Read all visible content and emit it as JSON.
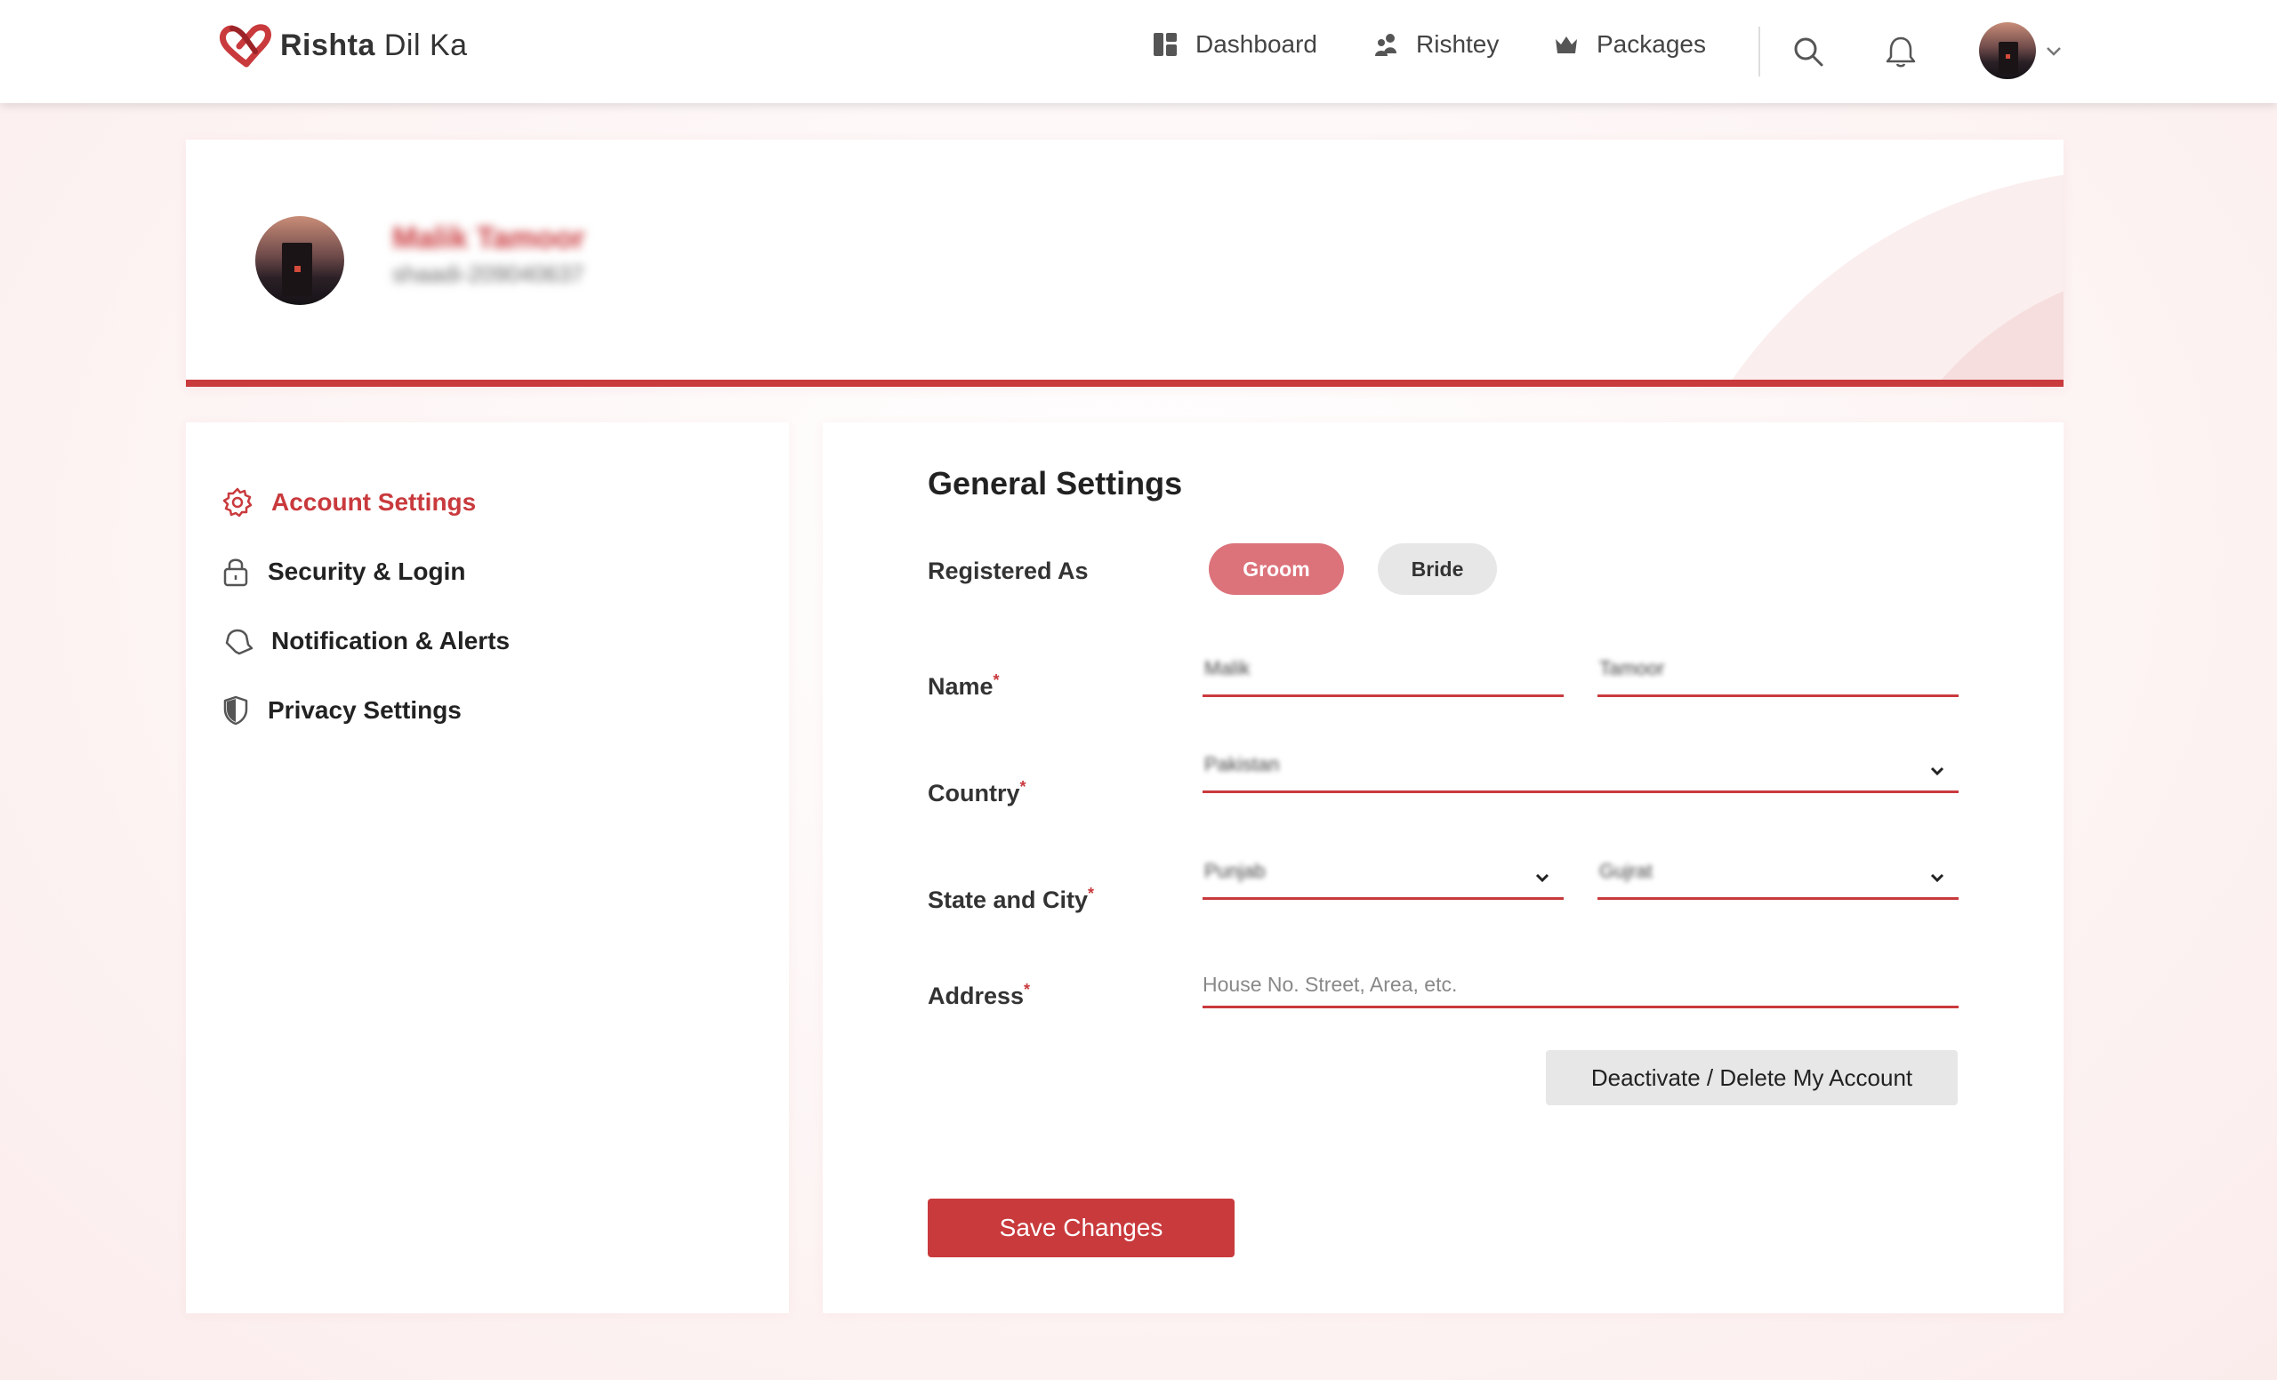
{
  "brand": {
    "name_bold": "Rishta",
    "name_light": " Dil Ka",
    "accent": "#c93a3d"
  },
  "nav": {
    "items": [
      {
        "label": "Dashboard",
        "icon": "dashboard-icon"
      },
      {
        "label": "Rishtey",
        "icon": "people-icon"
      },
      {
        "label": "Packages",
        "icon": "crown-icon"
      }
    ],
    "search_icon": "search-icon",
    "bell_icon": "bell-icon",
    "avatar_menu_icon": "chevron-down-icon"
  },
  "profile": {
    "name": "Malik Tamoor",
    "id": "shaadi-209040637"
  },
  "sidebar": {
    "items": [
      {
        "label": "Account Settings",
        "icon": "gear-icon",
        "active": true
      },
      {
        "label": "Security & Login",
        "icon": "lock-icon",
        "active": false
      },
      {
        "label": "Notification & Alerts",
        "icon": "bell-icon",
        "active": false
      },
      {
        "label": "Privacy Settings",
        "icon": "shield-icon",
        "active": false
      }
    ]
  },
  "form": {
    "title": "General Settings",
    "registered_as": {
      "label": "Registered As",
      "options": [
        "Groom",
        "Bride"
      ],
      "selected": "Groom"
    },
    "name": {
      "label": "Name",
      "required_mark": "*",
      "first": "Malik",
      "last": "Tamoor"
    },
    "country": {
      "label": "Country",
      "required_mark": "*",
      "value": "Pakistan"
    },
    "state_city": {
      "label": "State and City",
      "required_mark": "*",
      "state": "Punjab",
      "city": "Gujrat"
    },
    "address": {
      "label": "Address",
      "required_mark": "*",
      "placeholder": "House No. Street, Area, etc."
    },
    "deactivate_label": "Deactivate / Delete My Account",
    "save_label": "Save Changes"
  }
}
